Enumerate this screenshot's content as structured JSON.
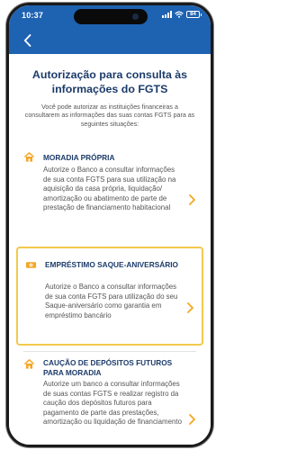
{
  "status_bar": {
    "time": "10:37",
    "battery": "84"
  },
  "colors": {
    "header": "#1e62b2",
    "title": "#1c3b6a",
    "accent": "#f5a623",
    "highlight_border": "#f2c94c"
  },
  "header": {
    "back_icon": "chevron-left-icon"
  },
  "page": {
    "title": "Autorização para consulta às informações do FGTS",
    "subtitle": "Você pode autorizar as instituições financeiras a consultarem as informações das suas contas FGTS para as seguintes situações:"
  },
  "options": [
    {
      "title": "MORADIA PRÓPRIA",
      "description": "Autorize o Banco a consultar informações de sua conta FGTS para sua utilização na aquisição da casa própria, liquidação/ amortização ou abatimento de parte de prestação de financiamento habitacional",
      "icon": "house-icon"
    },
    {
      "title": "EMPRÉSTIMO SAQUE-ANIVERSÁRIO",
      "description": "Autorize o Banco a consultar informações de sua conta FGTS para utilização do seu Saque-aniversário como garantia em empréstimo bancário",
      "icon": "money-icon"
    },
    {
      "title": "CAUÇÃO DE DEPÓSITOS FUTUROS PARA MORADIA",
      "description": "Autorize um banco a consultar informações de suas contas FGTS e realizar registro da caução dos depósitos futuros para pagamento de parte das prestações, amortização ou liquidação de financiamento",
      "icon": "house-icon"
    }
  ]
}
